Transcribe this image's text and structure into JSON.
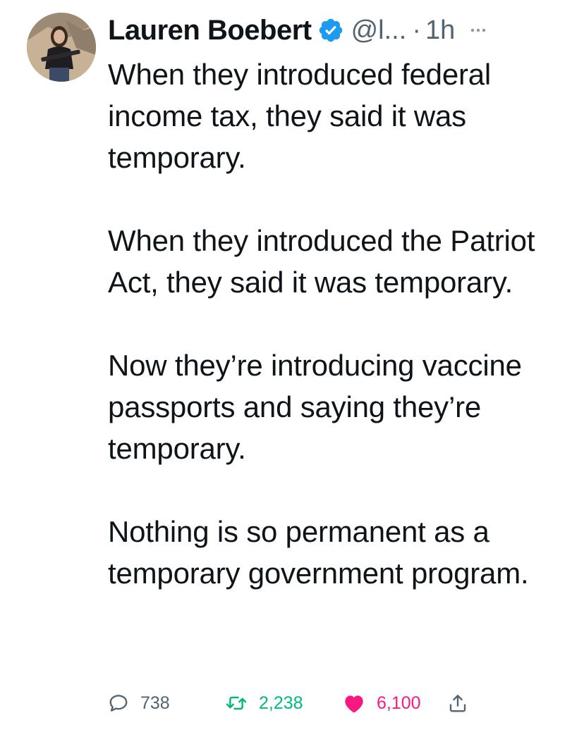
{
  "author": {
    "name": "Lauren Boebert",
    "handle": "@l...",
    "separator": "·",
    "time": "1h",
    "verified": true
  },
  "tweet": {
    "paragraphs": [
      "When they introduced federal income tax, they said it was temporary.",
      "When they introduced the Patriot Act, they said it was temporary.",
      "Now they’re introducing vaccine passports and saying they’re temporary.",
      "Nothing is so permanent as a temporary government program."
    ]
  },
  "actions": {
    "replies": "738",
    "retweets": "2,238",
    "likes": "6,100",
    "liked": true,
    "retweeted": true
  },
  "colors": {
    "verified_blue": "#1d9bf0",
    "retweet_green": "#00ba7c",
    "like_pink": "#f91880",
    "secondary_text": "#536471"
  },
  "icons": {
    "reply": "speech-bubble-icon",
    "retweet": "retweet-arrows-icon",
    "like": "heart-icon",
    "share": "share-upload-icon",
    "more": "ellipsis-icon",
    "verified": "verified-badge-icon"
  }
}
